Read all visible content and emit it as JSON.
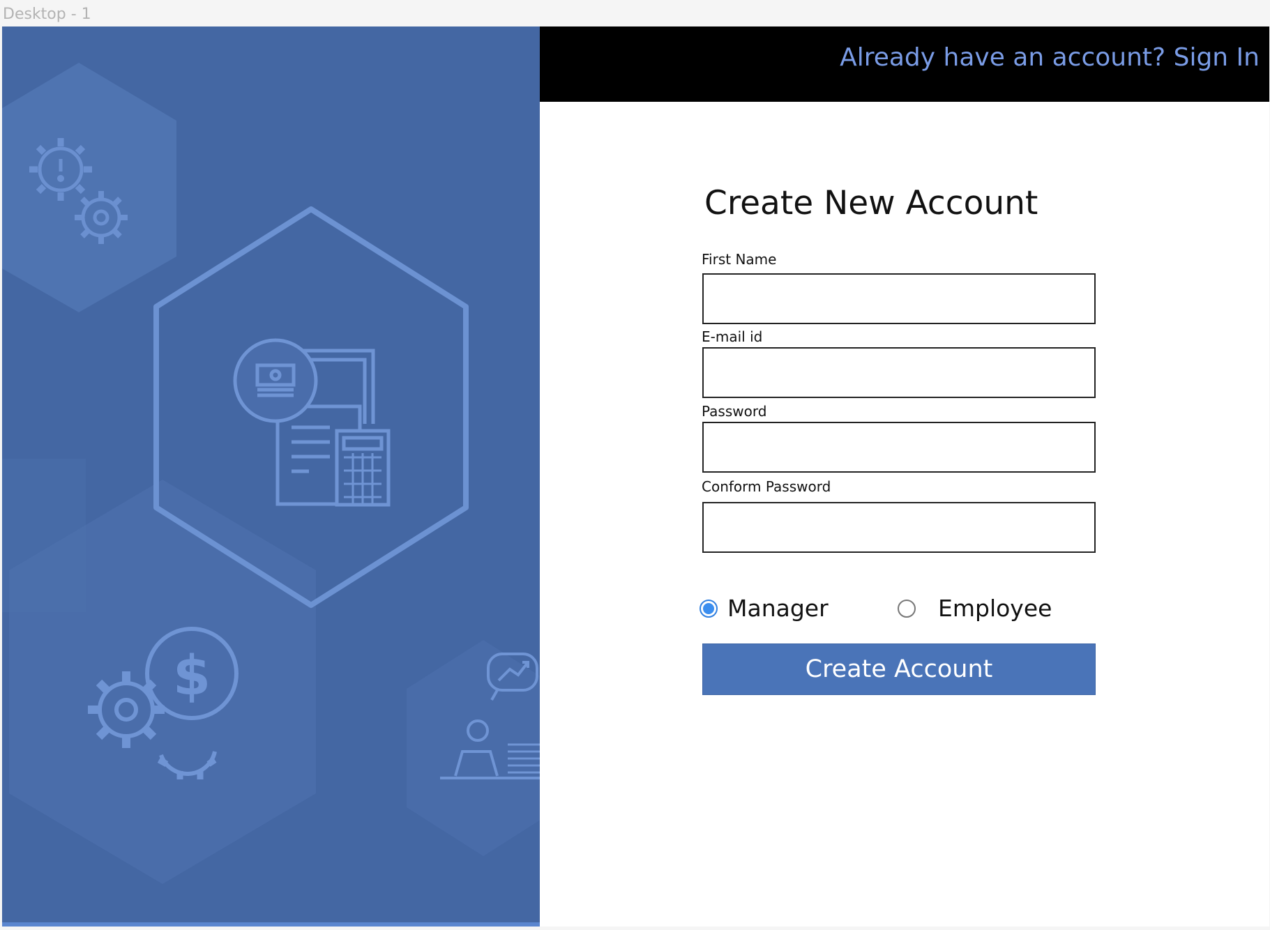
{
  "canvas": {
    "frame_label": "Desktop - 1"
  },
  "header": {
    "signin_text": "Already have an account? Sign In"
  },
  "form": {
    "title": "Create New Account",
    "fields": [
      {
        "label": "First Name",
        "value": "",
        "placeholder": ""
      },
      {
        "label": "E-mail id",
        "value": "",
        "placeholder": ""
      },
      {
        "label": "Password",
        "value": "",
        "placeholder": ""
      },
      {
        "label": "Conform Password",
        "value": "",
        "placeholder": ""
      }
    ],
    "role_options": [
      {
        "label": "Manager",
        "selected": true
      },
      {
        "label": "Employee",
        "selected": false
      }
    ],
    "submit_label": "Create Account"
  },
  "illustration": {
    "icons": [
      "gear-warning-icon",
      "gear-icon",
      "invoice-calculator-icon",
      "money-magnifier-icon",
      "dollar-gears-icon",
      "presenter-chart-icon"
    ]
  },
  "colors": {
    "panel_blue": "#4467a3",
    "accent_link": "#7a9ce6",
    "button_blue": "#4a74b8",
    "radio_blue": "#3b8eef"
  }
}
